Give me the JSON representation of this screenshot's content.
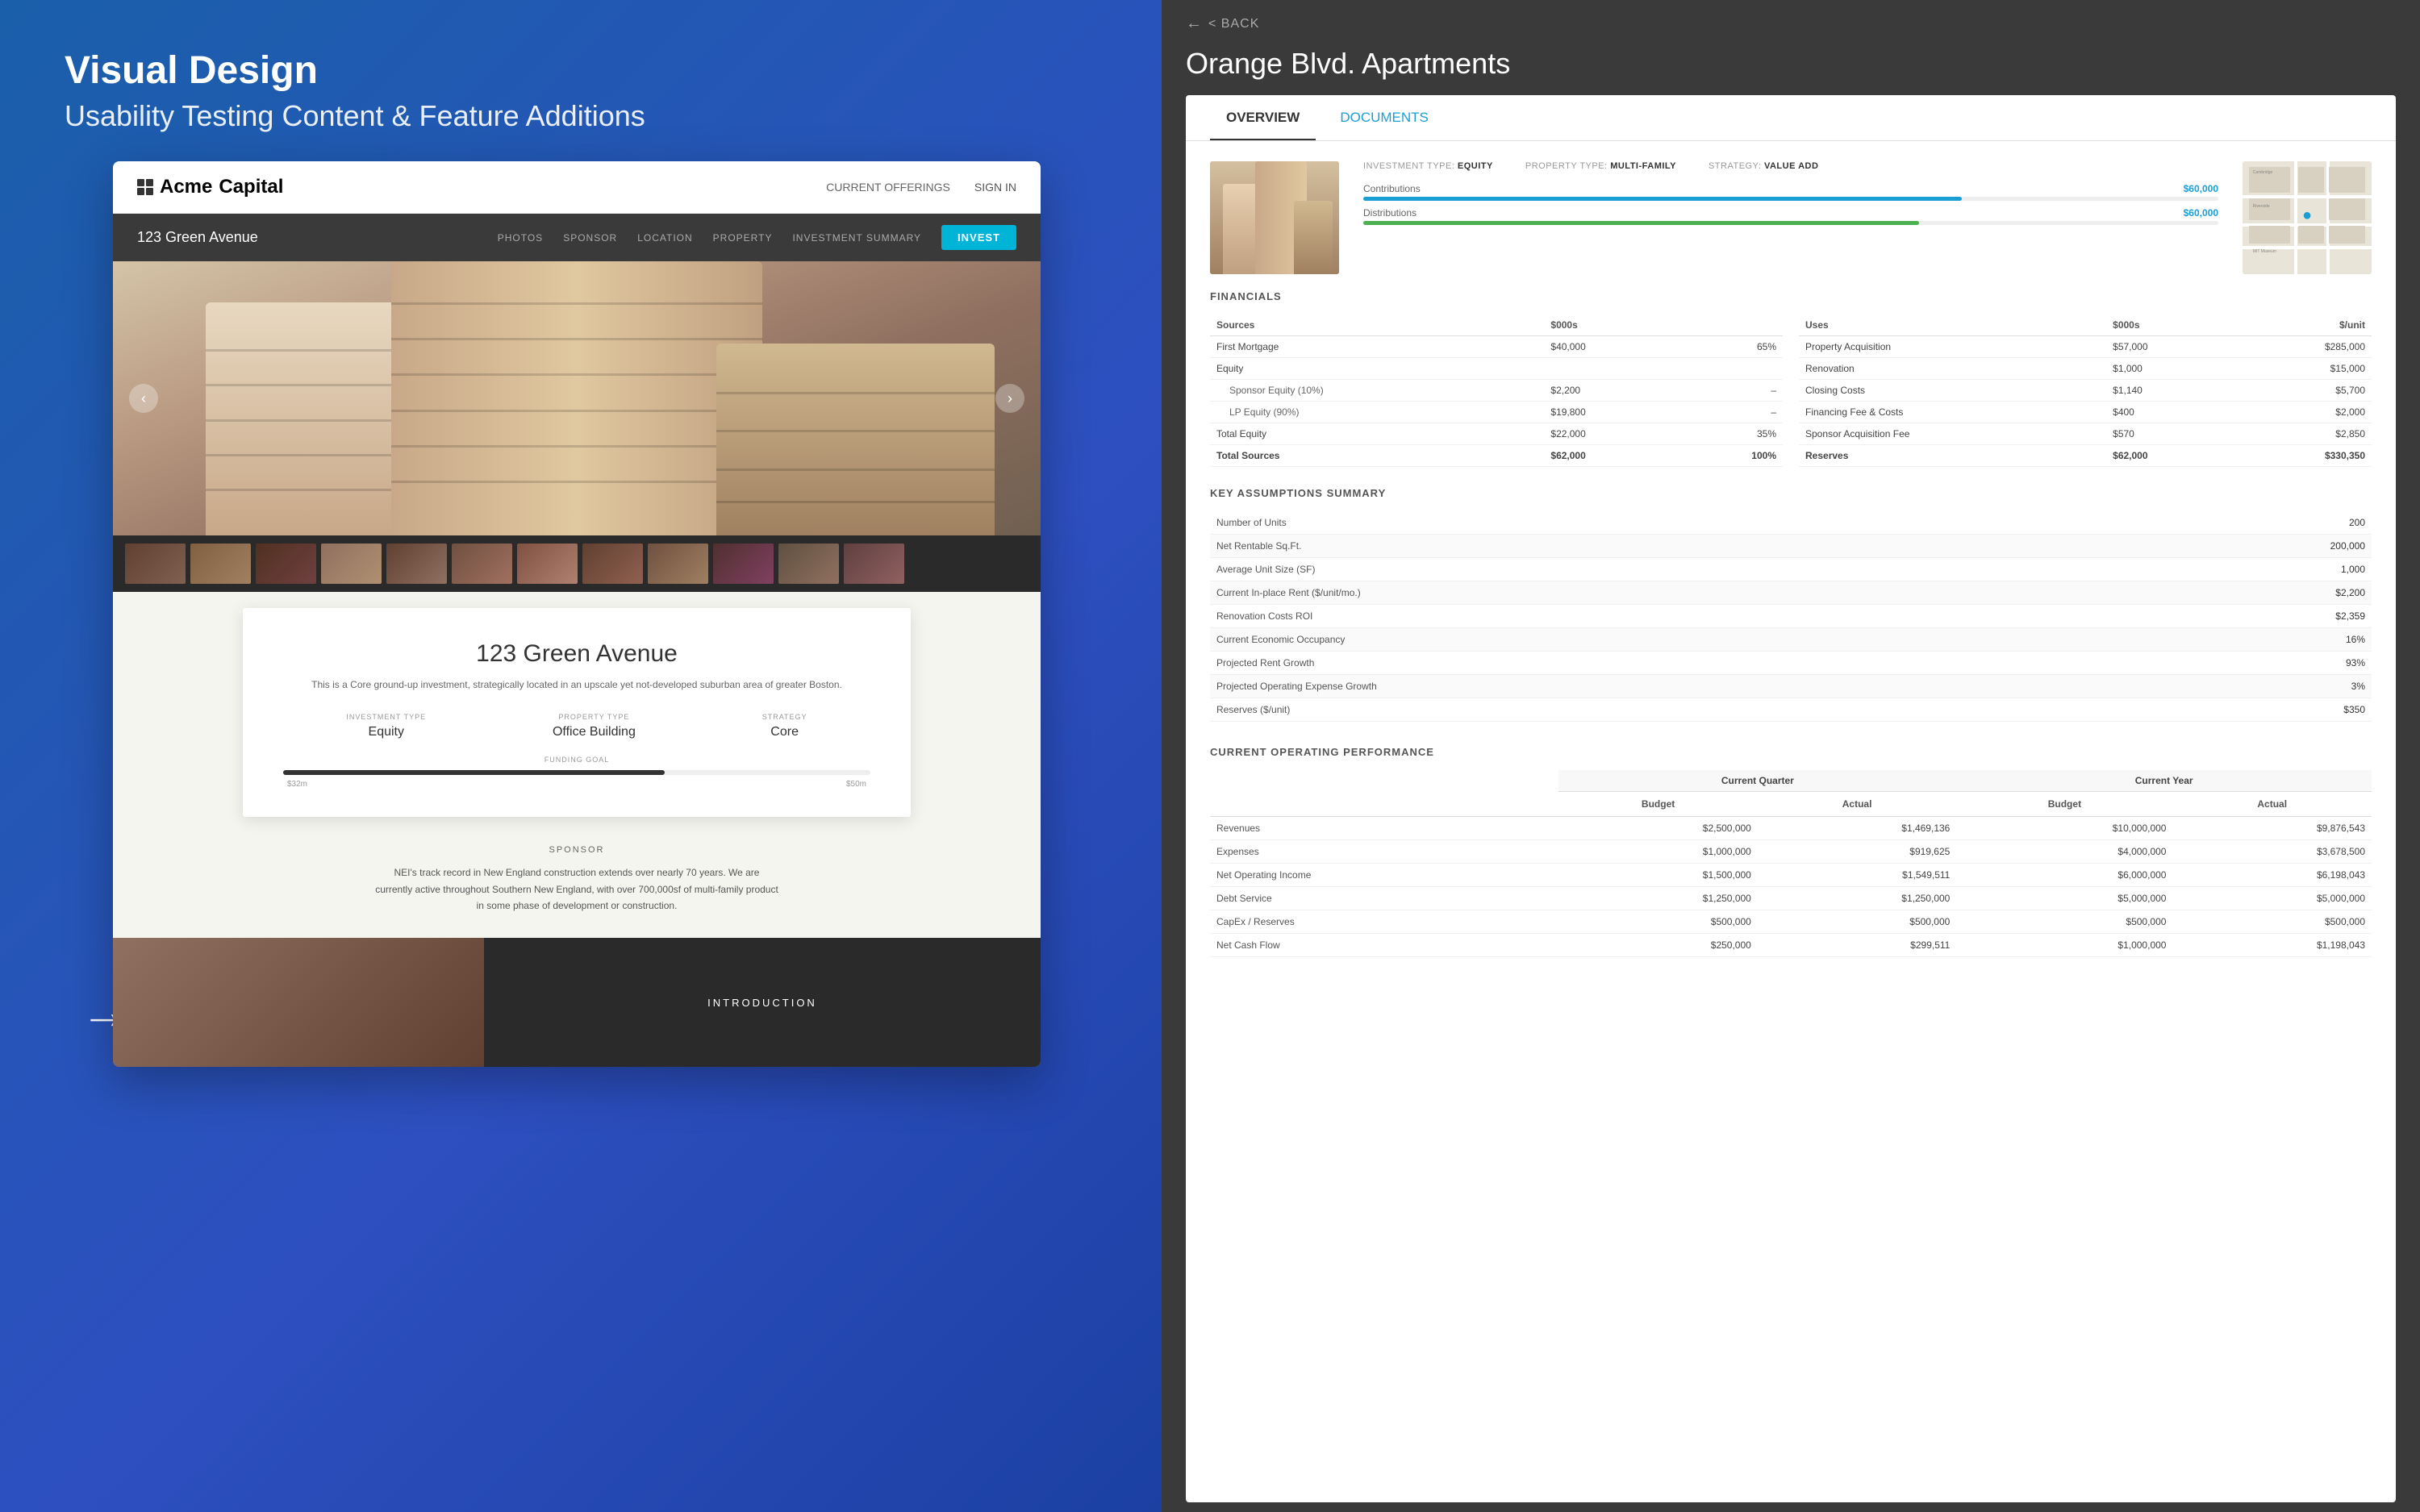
{
  "page": {
    "title": "Visual Design",
    "subtitle": "Usability Testing Content & Feature Additions"
  },
  "nav": {
    "logo_text": "AcmeCapital",
    "logo_acme": "Acme",
    "logo_capital": "Capital",
    "links": [
      "CURRENT OFFERINGS",
      "SIGN IN"
    ]
  },
  "property_nav": {
    "title": "123 Green Avenue",
    "links": [
      "PHOTOS",
      "SPONSOR",
      "LOCATION",
      "PROPERTY",
      "INVESTMENT SUMMARY"
    ],
    "invest_label": "INVEST"
  },
  "info_card": {
    "title": "123 Green Avenue",
    "description": "This is a Core ground-up investment, strategically located in an upscale yet not-developed suburban area of greater Boston.",
    "investment_type_label": "INVESTMENT TYPE",
    "investment_type_value": "Equity",
    "property_type_label": "PROPERTY TYPE",
    "property_type_value": "Office Building",
    "strategy_label": "STRATEGY",
    "strategy_value": "Core",
    "funding_label": "FUNDING GOAL",
    "funding_amount1": "$32m",
    "funding_amount2": "$50m"
  },
  "sponsor": {
    "label": "SPONSOR",
    "description": "NEI's track record in New England construction extends over nearly 70 years. We are currently active throughout Southern New England, with over 700,000sf of multi-family product in some phase of development or construction."
  },
  "introduction_label": "INTRODUCTION",
  "right_panel": {
    "back_label": "< BACK",
    "property_title": "Orange Blvd. Apartments",
    "tabs": [
      "OVERVIEW",
      "DOCUMENTS"
    ],
    "meta": {
      "investment_type_label": "INVESTMENT TYPE:",
      "investment_type_value": "EQUITY",
      "property_type_label": "PROPERTY TYPE:",
      "property_type_value": "MULTI-FAMILY",
      "strategy_label": "STRATEGY:",
      "strategy_value": "VALUE ADD"
    },
    "contributions": {
      "label": "Contributions",
      "amount": "$60,000",
      "percent": 70
    },
    "distributions": {
      "label": "Distributions",
      "amount": "$60,000",
      "percent": 65
    },
    "financials": {
      "title": "FINANCIALS",
      "sources_header": "Sources",
      "uses_header": "Uses",
      "thousands_label": "$000s",
      "per_unit_label": "$/unit",
      "rows_sources": [
        {
          "label": "First Mortgage",
          "value": "$40,000",
          "pct": "65%"
        },
        {
          "label": "Equity",
          "value": "",
          "pct": ""
        },
        {
          "label": "Sponsor Equity (10%)",
          "value": "$2,200",
          "pct": "–",
          "indent": true
        },
        {
          "label": "LP Equity (90%)",
          "value": "$19,800",
          "pct": "–",
          "indent": true
        },
        {
          "label": "Total Equity",
          "value": "$22,000",
          "pct": "35%"
        },
        {
          "label": "Total Sources",
          "value": "$62,000",
          "pct": "100%",
          "total": true
        }
      ],
      "rows_uses": [
        {
          "label": "Property Acquisition",
          "value": "$57,000",
          "per_unit": "$285,000"
        },
        {
          "label": "Renovation",
          "value": "$1,000",
          "per_unit": "$15,000"
        },
        {
          "label": "Closing Costs",
          "value": "$1,140",
          "per_unit": "$5,700"
        },
        {
          "label": "Financing Fee & Costs",
          "value": "$400",
          "per_unit": "$2,000"
        },
        {
          "label": "Sponsor Acquisition Fee",
          "value": "$570",
          "per_unit": "$2,850"
        },
        {
          "label": "Reserves",
          "value": "$62,000",
          "per_unit": "$330,350",
          "total": true
        }
      ]
    },
    "key_assumptions": {
      "title": "KEY ASSUMPTIONS SUMMARY",
      "rows": [
        {
          "label": "Number of Units",
          "value": "200"
        },
        {
          "label": "Net Rentable Sq.Ft.",
          "value": "200,000"
        },
        {
          "label": "Average Unit Size (SF)",
          "value": "1,000"
        },
        {
          "label": "Current In-place Rent ($/unit/mo.)",
          "value": "$2,200"
        },
        {
          "label": "Renovation Costs ROI",
          "value": "$2,359"
        },
        {
          "label": "Current Economic Occupancy",
          "value": "16%"
        },
        {
          "label": "Projected Rent Growth",
          "value": "93%"
        },
        {
          "label": "Projected Operating Expense Growth",
          "value": "3%"
        },
        {
          "label": "Reserves ($/unit)",
          "value": "$350"
        }
      ]
    },
    "operating_performance": {
      "title": "CURRENT OPERATING PERFORMANCE",
      "headers": {
        "row_label": "",
        "current_quarter": "Current Quarter",
        "current_year": "Current Year"
      },
      "sub_headers": [
        "Budget",
        "Actual",
        "Budget",
        "Actual"
      ],
      "rows": [
        {
          "label": "Revenues",
          "cq_budget": "$2,500,000",
          "cq_actual": "$1,469,136",
          "cy_budget": "$10,000,000",
          "cy_actual": "$9,876,543"
        },
        {
          "label": "Expenses",
          "cq_budget": "$1,000,000",
          "cq_actual": "$919,625",
          "cy_budget": "$4,000,000",
          "cy_actual": "$3,678,500"
        },
        {
          "label": "Net Operating Income",
          "cq_budget": "$1,500,000",
          "cq_actual": "$1,549,511",
          "cy_budget": "$6,000,000",
          "cy_actual": "$6,198,043"
        },
        {
          "label": "Debt Service",
          "cq_budget": "$1,250,000",
          "cq_actual": "$1,250,000",
          "cy_budget": "$5,000,000",
          "cy_actual": "$5,000,000"
        },
        {
          "label": "CapEx / Reserves",
          "cq_budget": "$500,000",
          "cq_actual": "$500,000",
          "cy_budget": "$500,000",
          "cy_actual": "$500,000"
        },
        {
          "label": "Net Cash Flow",
          "cq_budget": "$250,000",
          "cq_actual": "$299,511",
          "cy_budget": "$1,000,000",
          "cy_actual": "$1,198,043"
        }
      ]
    }
  }
}
